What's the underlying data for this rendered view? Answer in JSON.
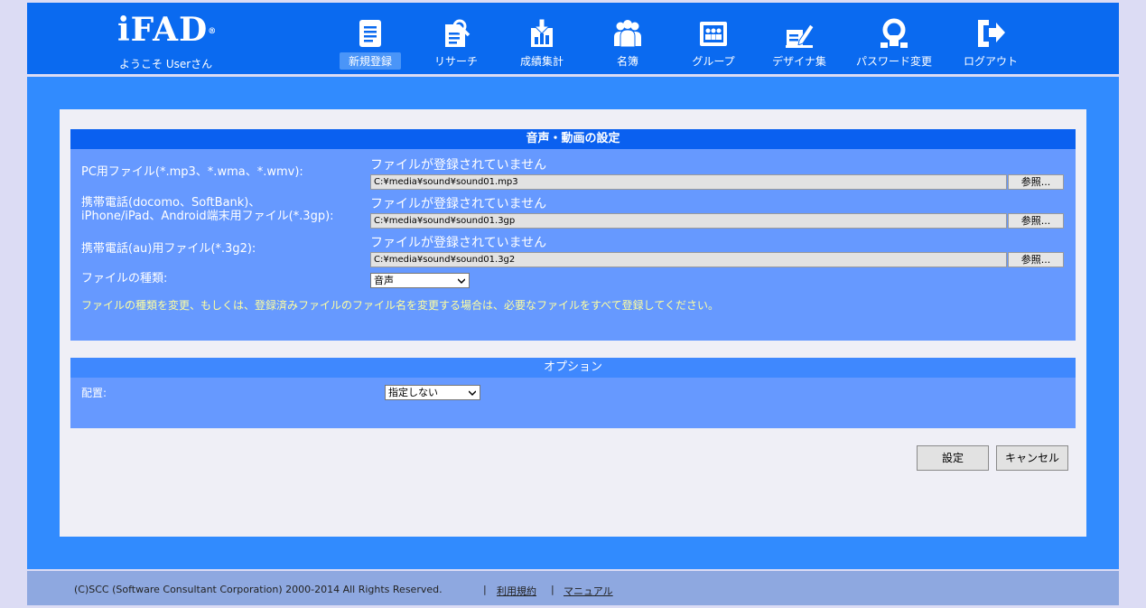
{
  "brand": {
    "logo": "iFAD",
    "reg": "®",
    "welcome": "ようこそ Userさん"
  },
  "nav": [
    {
      "label": "新規登録",
      "icon": "document-icon",
      "active": true
    },
    {
      "label": "リサーチ",
      "icon": "research-icon"
    },
    {
      "label": "成績集計",
      "icon": "download-chart-icon"
    },
    {
      "label": "名簿",
      "icon": "people-icon"
    },
    {
      "label": "グループ",
      "icon": "group-icon"
    },
    {
      "label": "デザイナ集",
      "icon": "designer-pen-icon"
    },
    {
      "label": "パスワード変更",
      "icon": "password-icon"
    },
    {
      "label": "ログアウト",
      "icon": "logout-icon"
    }
  ],
  "media": {
    "title": "音声・動画の設定",
    "rows": [
      {
        "label": "PC用ファイル(*.mp3、*.wma、*.wmv):",
        "status": "ファイルが登録されていません",
        "path": "C:¥media¥sound¥sound01.mp3",
        "browse": "参照..."
      },
      {
        "label_line1": "携帯電話(docomo、SoftBank)、",
        "label_line2": "iPhone/iPad、Android端末用ファイル(*.3gp):",
        "status": "ファイルが登録されていません",
        "path": "C:¥media¥sound¥sound01.3gp",
        "browse": "参照..."
      },
      {
        "label": "携帯電話(au)用ファイル(*.3g2):",
        "status": "ファイルが登録されていません",
        "path": "C:¥media¥sound¥sound01.3g2",
        "browse": "参照..."
      }
    ],
    "type_label": "ファイルの種類:",
    "type_value": "音声",
    "notice": "ファイルの種類を変更、もしくは、登録済みファイルのファイル名を変更する場合は、必要なファイルをすべて登録してください。"
  },
  "option": {
    "title": "オプション",
    "layout_label": "配置:",
    "layout_value": "指定しない"
  },
  "buttons": {
    "ok": "設定",
    "cancel": "キャンセル"
  },
  "footer": {
    "copyright": "(C)SCC (Software Consultant Corporation) 2000-2014 All Rights Reserved.",
    "sep": "|",
    "terms": "利用規約",
    "manual": "マニュアル"
  },
  "colors": {
    "header": "#0a6af0",
    "band": "#318bfe",
    "section": "#6699ff",
    "section_head": "#0a60f0",
    "notice": "#ffffa0",
    "footer": "#8ea8e0"
  }
}
